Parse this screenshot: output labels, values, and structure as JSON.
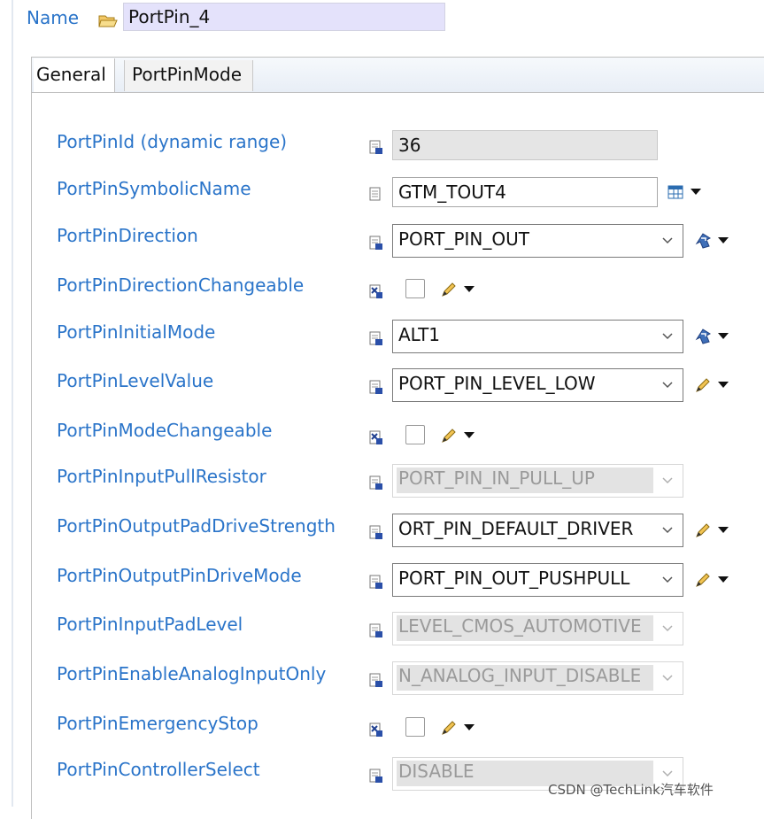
{
  "header": {
    "name_label": "Name",
    "name_value": "PortPin_4"
  },
  "tabs": [
    {
      "label": "General",
      "active": true
    },
    {
      "label": "PortPinMode",
      "active": false
    }
  ],
  "params": [
    {
      "label": "PortPinId (dynamic range)",
      "kind": "readonly-text",
      "value": "36"
    },
    {
      "label": "PortPinSymbolicName",
      "kind": "text",
      "value": "GTM_TOUT4",
      "extra_icon": "table-link-icon"
    },
    {
      "label": "PortPinDirection",
      "kind": "combo",
      "value": "PORT_PIN_OUT",
      "extra_icon": "derived-value-icon"
    },
    {
      "label": "PortPinDirectionChangeable",
      "kind": "checkbox",
      "checked": false,
      "extra_icon": "pencil-icon"
    },
    {
      "label": "PortPinInitialMode",
      "kind": "combo",
      "value": "ALT1",
      "extra_icon": "derived-value-icon"
    },
    {
      "label": "PortPinLevelValue",
      "kind": "combo",
      "value": "PORT_PIN_LEVEL_LOW",
      "extra_icon": "pencil-icon"
    },
    {
      "label": "PortPinModeChangeable",
      "kind": "checkbox",
      "checked": false,
      "extra_icon": "pencil-icon"
    },
    {
      "label": "PortPinInputPullResistor",
      "kind": "combo-disabled",
      "value": "PORT_PIN_IN_PULL_UP"
    },
    {
      "label": "PortPinOutputPadDriveStrength",
      "kind": "combo",
      "value": "PORT_PIN_DEFAULT_DRIVER",
      "extra_icon": "pencil-icon"
    },
    {
      "label": "PortPinOutputPinDriveMode",
      "kind": "combo",
      "value": "PORT_PIN_OUT_PUSHPULL",
      "extra_icon": "pencil-icon"
    },
    {
      "label": "PortPinInputPadLevel",
      "kind": "combo-disabled",
      "value": "LEVEL_CMOS_AUTOMOTIVE"
    },
    {
      "label": "PortPinEnableAnalogInputOnly",
      "kind": "combo-disabled",
      "value": "N_ANALOG_INPUT_DISABLE"
    },
    {
      "label": "PortPinEmergencyStop",
      "kind": "checkbox",
      "checked": false,
      "extra_icon": "pencil-icon"
    },
    {
      "label": "PortPinControllerSelect",
      "kind": "combo-disabled",
      "value": "DISABLE"
    }
  ],
  "watermark": "CSDN @TechLink汽车软件",
  "colors": {
    "label_blue": "#2a74c9",
    "name_field_bg": "#e4e2fb",
    "readonly_bg": "#e5e5e5"
  }
}
